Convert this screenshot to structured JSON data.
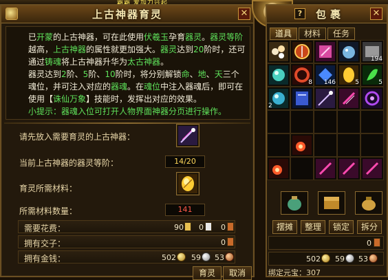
{
  "banner": {
    "top_text": "霸霸 爱加力兴起"
  },
  "refine": {
    "title": "上古神器育灵",
    "desc": {
      "p1": {
        "a": "已",
        "b": "开蒙",
        "c": "的上古神器，可在此使用",
        "d": "伏羲玉",
        "e": "孕育",
        "f": "器灵",
        "g": "。",
        "h": "器灵等阶",
        "i": "越高，",
        "j": "上古神器",
        "k": "的属性就更加强大。",
        "l": "器灵",
        "m": "达到",
        "n": "20",
        "o": "阶时，还可通过",
        "p": "铸魂",
        "q": "将上古神器升华为",
        "r": "太古神器",
        "s": "。"
      },
      "p2": {
        "a": "器灵达到",
        "b": "2",
        "c": "阶、",
        "d": "5",
        "e": "阶、",
        "f": "10",
        "g": "阶时，将分别解锁",
        "h": "命",
        "i": "、",
        "j": "地",
        "k": "、",
        "l": "天",
        "m": "三个魂位，并可注入对应的",
        "n": "器魂",
        "o": "。在",
        "p": "魂位",
        "q": "中注入器魂后，即可在使用【",
        "r": "诛仙万象",
        "s": "】技能时，发挥出对应的效果。"
      },
      "tip": "小提示：器魂入位可打开人物界面神器分页进行操作。"
    },
    "put_label": "请先放入需要育灵的上古神器：",
    "level_label": "当前上古神器的器灵等阶：",
    "level_value": "14/20",
    "material_label": "育灵所需材料：",
    "qty_label": "所需材料数量：",
    "qty_value": "141",
    "cost_label": "需要花费：",
    "cost_gold_ingot": "90",
    "cost_silver_ingot": "0",
    "cost_copper_ingot": "0",
    "jiaozi_label": "拥有交子：",
    "jiaozi_value": "0",
    "money_label": "拥有金钱：",
    "money_gold": "502",
    "money_silver": "59",
    "money_copper": "53",
    "btn_refine": "育灵",
    "btn_cancel": "取消"
  },
  "bag": {
    "title": "包裹",
    "help": "?",
    "tabs": [
      "道具",
      "材料",
      "任务"
    ],
    "counts": {
      "c5": "194",
      "c9": "8",
      "c10": "146",
      "c11": "5",
      "c12": "5",
      "c14": "2"
    },
    "actions": [
      "摆摊",
      "整理",
      "锁定",
      "拆分"
    ],
    "jiaozi_value": "0",
    "money_gold": "502",
    "money_silver": "59",
    "money_copper": "53",
    "bound_label": "绑定元宝：",
    "bound_value": "307"
  },
  "colors": {
    "accent_gold": "#c8953a",
    "text_green": "#5ee05a",
    "text_red": "#ff5a4a"
  }
}
